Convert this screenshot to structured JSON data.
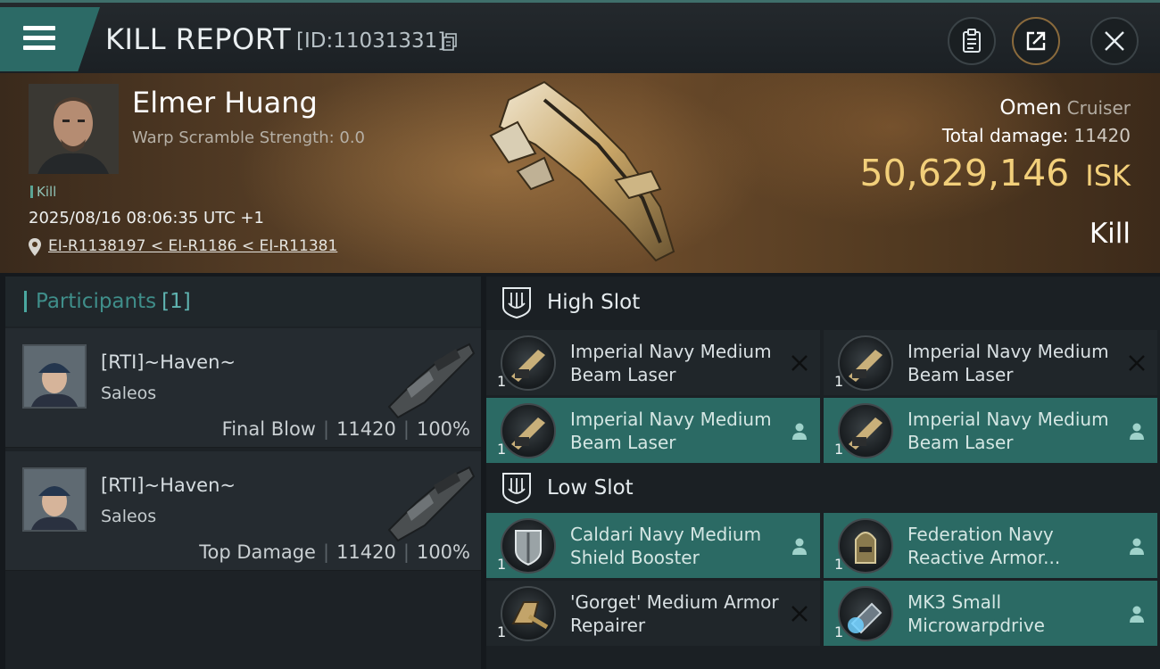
{
  "header": {
    "title": "KILL REPORT",
    "id_label": "[ID:11031331]",
    "icons": [
      "menu-icon",
      "copy-icon",
      "clipboard-icon",
      "share-icon",
      "close-icon"
    ]
  },
  "victim": {
    "name": "Elmer Huang",
    "warp_scramble": "Warp Scramble Strength: 0.0",
    "tag": "Kill",
    "timestamp": "2025/08/16 08:06:35 UTC +1",
    "location": "EI-R1138197 < EI-R1186 < EI-R11381"
  },
  "ship": {
    "name": "Omen",
    "class": "Cruiser",
    "total_damage_label": "Total damage:",
    "total_damage_value": "11420",
    "isk_value": "50,629,146",
    "isk_unit": "ISK",
    "result": "Kill"
  },
  "participants": {
    "title": "Participants",
    "count": "[1]",
    "cards": [
      {
        "name": "[RTI]~Haven~",
        "ship": "Saleos",
        "role": "Final Blow",
        "damage": "11420",
        "percent": "100%"
      },
      {
        "name": "[RTI]~Haven~",
        "ship": "Saleos",
        "role": "Top Damage",
        "damage": "11420",
        "percent": "100%"
      }
    ]
  },
  "fitting": {
    "high_slot": {
      "label": "High Slot",
      "modules": [
        {
          "name": "Imperial Navy Medium Beam Laser",
          "qty": "1",
          "status": "destroyed"
        },
        {
          "name": "Imperial Navy Medium Beam Laser",
          "qty": "1",
          "status": "destroyed"
        },
        {
          "name": "Imperial Navy Medium Beam Laser",
          "qty": "1",
          "status": "dropped"
        },
        {
          "name": "Imperial Navy Medium Beam Laser",
          "qty": "1",
          "status": "dropped"
        }
      ]
    },
    "low_slot": {
      "label": "Low Slot",
      "modules": [
        {
          "name": "Caldari Navy Medium Shield Booster",
          "qty": "1",
          "status": "dropped"
        },
        {
          "name": "Federation Navy Reactive Armor...",
          "qty": "1",
          "status": "dropped"
        },
        {
          "name": "'Gorget' Medium Armor Repairer",
          "qty": "1",
          "status": "destroyed"
        },
        {
          "name": "MK3 Small Microwarpdrive",
          "qty": "1",
          "status": "dropped"
        }
      ]
    }
  },
  "colors": {
    "accent_teal": "#2b6a64",
    "isk_gold": "#f2cf7a",
    "panel_dark": "#1b2024"
  }
}
